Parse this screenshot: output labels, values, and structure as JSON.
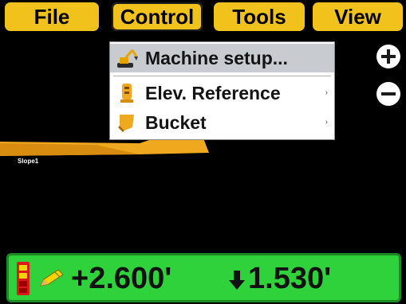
{
  "menubar": {
    "file_label": "File",
    "control_label": "Control",
    "tools_label": "Tools",
    "view_label": "View"
  },
  "dropdown": {
    "items": [
      {
        "label": "Machine setup...",
        "icon": "excavator-icon",
        "has_submenu": false,
        "highlighted": true
      },
      {
        "label": "Elev. Reference",
        "icon": "grade-rod-icon",
        "has_submenu": true,
        "highlighted": false
      },
      {
        "label": "Bucket",
        "icon": "bucket-icon",
        "has_submenu": true,
        "highlighted": false
      }
    ],
    "submenu_arrow": "›"
  },
  "zoom": {
    "in_icon": "plus-icon",
    "out_icon": "minus-icon"
  },
  "view": {
    "slope_label": "Slope1"
  },
  "status": {
    "elevation_value": "+2.600'",
    "depth_value": "1.530'",
    "lightbar_icon": "lightbar-icon",
    "edit_icon": "pencil-icon",
    "depth_icon": "down-arrow-icon",
    "background_color": "#2fd23a"
  },
  "colors": {
    "menu_button": "#f2c21c",
    "terrain": "#f0a81e",
    "screen_background": "#000000"
  }
}
